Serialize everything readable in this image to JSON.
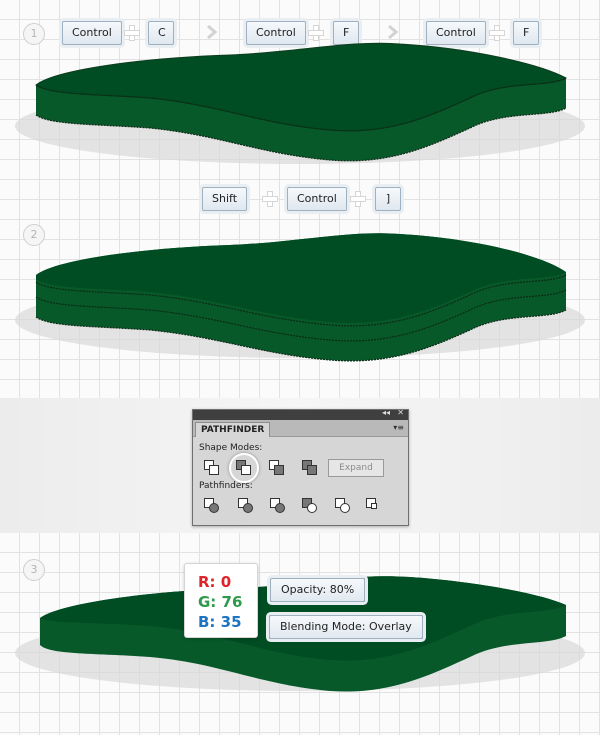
{
  "steps": [
    "1",
    "2",
    "3"
  ],
  "step1": {
    "keys": [
      "Control",
      "C",
      "Control",
      "F",
      "Control",
      "F"
    ]
  },
  "step2": {
    "keys": [
      "Shift",
      "Control",
      "]"
    ]
  },
  "pathfinder": {
    "title": "PATHFINDER",
    "collapse_glyph": "◂◂",
    "close_glyph": "✕",
    "menu_glyph": "▾≡",
    "shape_modes_label": "Shape Modes:",
    "pathfinders_label": "Pathfinders:",
    "expand_label": "Expand"
  },
  "step3": {
    "r": "R: 0",
    "g": "G: 76",
    "b": "B: 35",
    "opacity": "Opacity: 80%",
    "blending": "Blending Mode: Overlay"
  },
  "colors": {
    "green_top": "#004c23",
    "green_side": "#055a27",
    "red": "#e0242a",
    "green_text": "#2c9a4a",
    "blue_text": "#1e73c2"
  }
}
